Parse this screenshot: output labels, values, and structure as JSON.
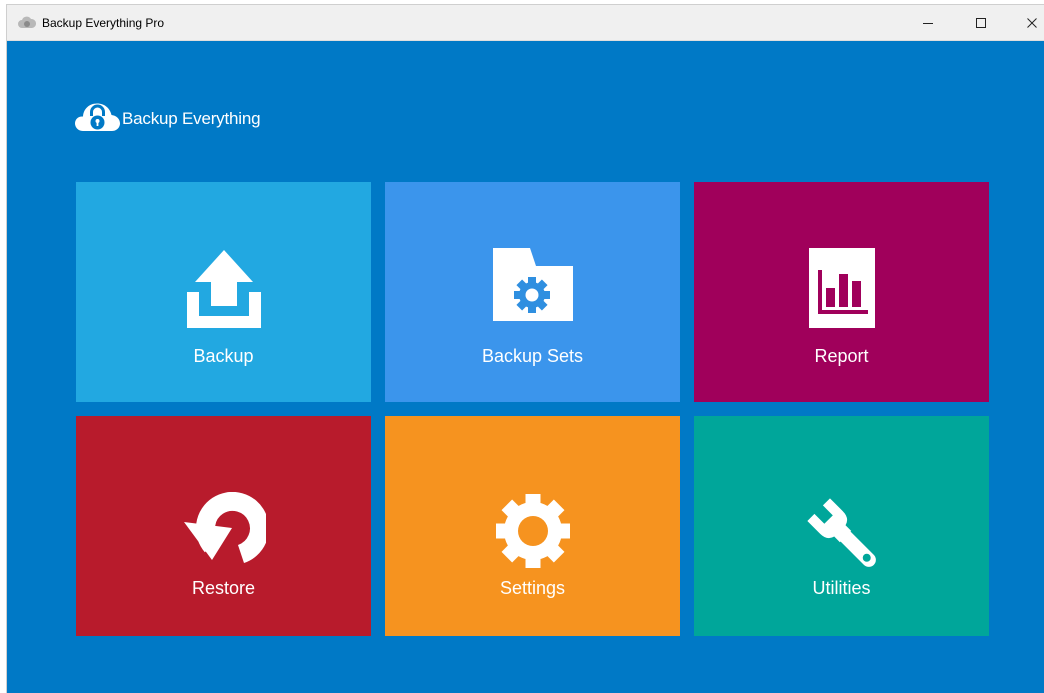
{
  "window": {
    "title": "Backup Everything Pro",
    "app_icon": "cloud-lock-icon",
    "controls": {
      "minimize": "minimize-icon",
      "maximize": "maximize-icon",
      "close": "close-icon"
    }
  },
  "brand": {
    "name": "Backup Everything",
    "logo": "cloud-lock-icon"
  },
  "colors": {
    "background": "#0079c6",
    "titlebar": "#f0f0f0",
    "tile_backup": "#22a8e1",
    "tile_backup_sets": "#3b95ec",
    "tile_report": "#a0005b",
    "tile_restore": "#b81b2c",
    "tile_settings": "#f6931f",
    "tile_utilities": "#00a69a"
  },
  "tiles": [
    {
      "label": "Backup",
      "icon": "upload-icon",
      "color": "#22a8e1"
    },
    {
      "label": "Backup Sets",
      "icon": "folder-gear-icon",
      "color": "#3b95ec"
    },
    {
      "label": "Report",
      "icon": "bar-chart-icon",
      "color": "#a0005b"
    },
    {
      "label": "Restore",
      "icon": "restore-arrow-icon",
      "color": "#b81b2c"
    },
    {
      "label": "Settings",
      "icon": "gear-icon",
      "color": "#f6931f"
    },
    {
      "label": "Utilities",
      "icon": "wrench-icon",
      "color": "#00a69a"
    }
  ]
}
